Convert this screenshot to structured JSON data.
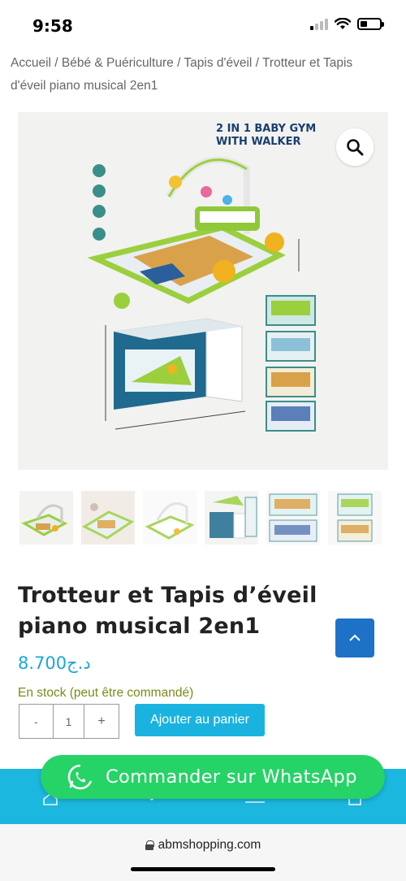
{
  "status": {
    "time": "9:58"
  },
  "breadcrumb": [
    "Accueil",
    "Bébé & Puériculture",
    "Tapis d'éveil",
    "Trotteur et Tapis d'éveil piano musical 2en1"
  ],
  "product": {
    "image_banner": [
      "2 IN 1 BABY GYM",
      "WITH WALKER"
    ],
    "title": "Trotteur et Tapis d’éveil piano musical 2en1",
    "price": "8.700",
    "currency": "د.ج",
    "stock": "En stock (peut être commandé)"
  },
  "cart": {
    "minus_label": "-",
    "quantity": "1",
    "plus_label": "+",
    "add_label": "Ajouter au panier"
  },
  "whatsapp": {
    "label": "Commander sur WhatsApp"
  },
  "browser": {
    "url": "abmshopping.com"
  },
  "colors": {
    "accent": "#1ab3e0",
    "price": "#1ca6d9",
    "stock": "#7a8b1a",
    "whatsapp": "#25d366",
    "scroll_top": "#1d72c8"
  },
  "icons": [
    "search-icon",
    "chevron-up-icon",
    "whatsapp-icon",
    "home-icon",
    "chevron-down-icon",
    "menu-icon",
    "cart-icon",
    "lock-icon",
    "wifi-icon",
    "battery-icon",
    "signal-icon"
  ]
}
